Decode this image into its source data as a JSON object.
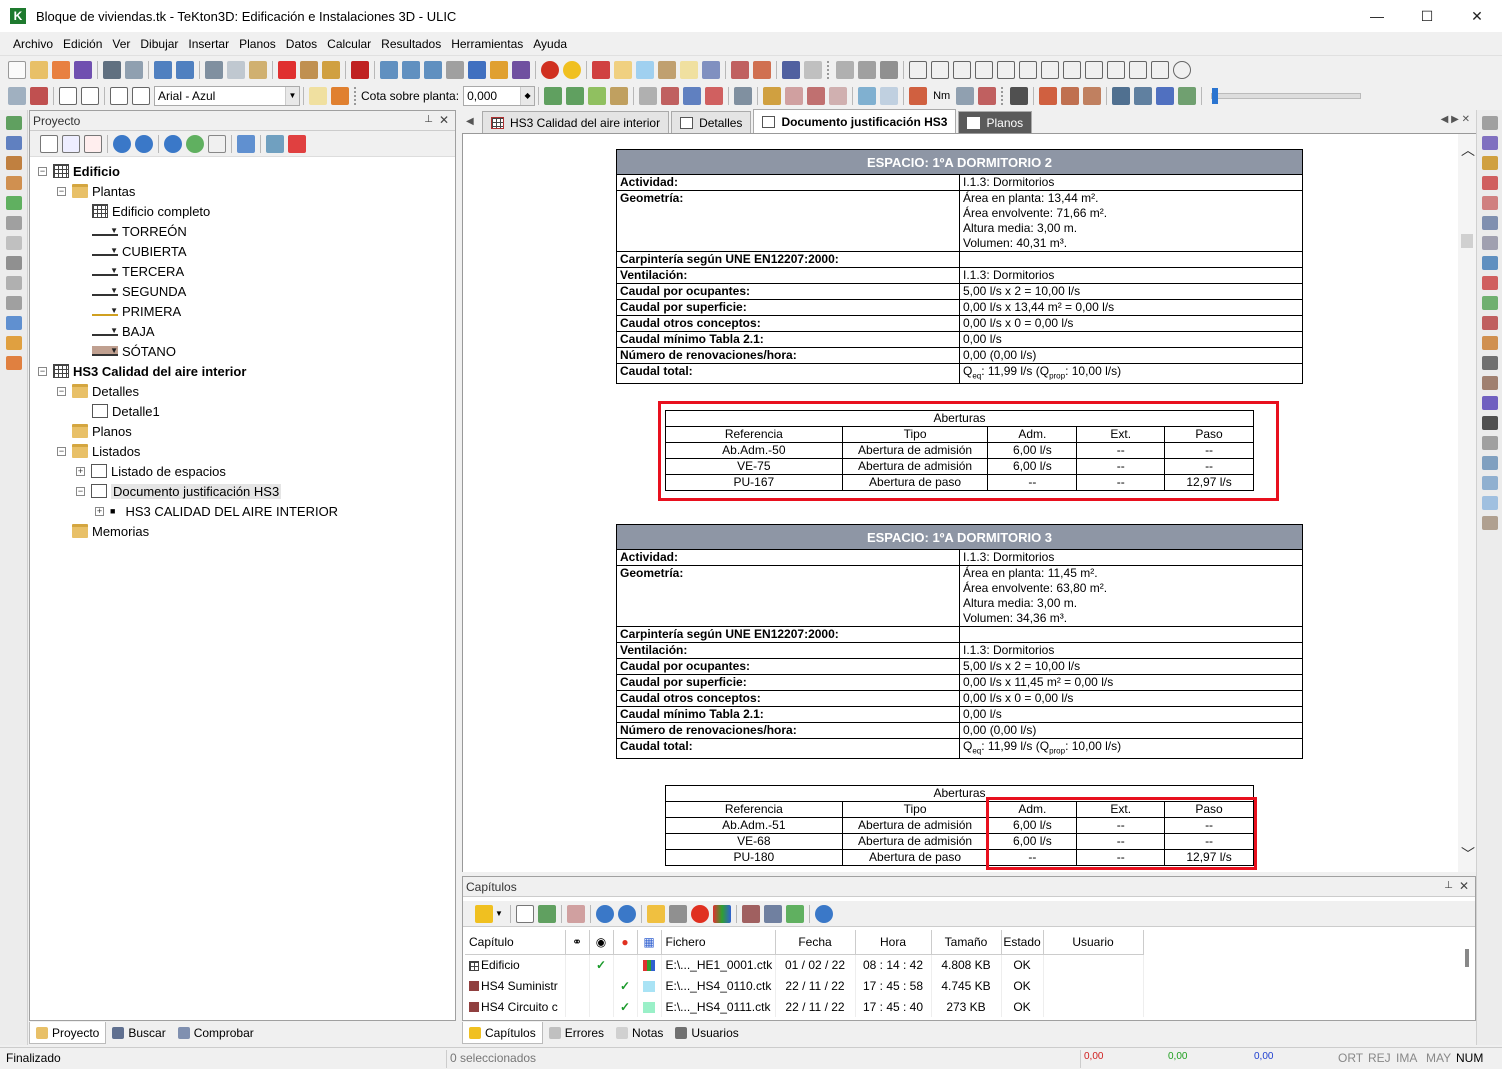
{
  "window": {
    "title": "Bloque de viviendas.tk - TeKton3D: Edificación e Instalaciones 3D - ULIC",
    "app_icon": "K",
    "minimize": "—",
    "maximize": "☐",
    "close": "✕"
  },
  "menu": [
    "Archivo",
    "Edición",
    "Ver",
    "Dibujar",
    "Insertar",
    "Planos",
    "Datos",
    "Calcular",
    "Resultados",
    "Herramientas",
    "Ayuda"
  ],
  "toolbar": {
    "font_combo": "Arial - Azul",
    "elevation_label": "Cota sobre planta:",
    "elevation_value": "0,000",
    "units": "Nm"
  },
  "project_panel": {
    "title": "Proyecto",
    "tree": {
      "edificio": "Edificio",
      "plantas": "Plantas",
      "edificio_completo": "Edificio completo",
      "levels": [
        "TORREÓN",
        "CUBIERTA",
        "TERCERA",
        "SEGUNDA",
        "PRIMERA",
        "BAJA",
        "SÓTANO"
      ],
      "hs3": "HS3 Calidad del aire interior",
      "detalles": "Detalles",
      "detalle1": "Detalle1",
      "planos": "Planos",
      "listados": "Listados",
      "listado_espacios": "Listado de espacios",
      "documento": "Documento justificación HS3",
      "hs3_upper": "HS3 CALIDAD DEL AIRE INTERIOR",
      "memorias": "Memorias"
    },
    "tabs": [
      "Proyecto",
      "Buscar",
      "Comprobar"
    ]
  },
  "doc_tabs": [
    "HS3 Calidad del aire interior",
    "Detalles",
    "Documento justificación HS3",
    "Planos"
  ],
  "document": {
    "spaces": [
      {
        "title": "ESPACIO: 1ºA DORMITORIO 2",
        "actividad_label": "Actividad:",
        "actividad": "I.1.3: Dormitorios",
        "geometria_label": "Geometría:",
        "area_planta": "Área en planta: 13,44 m².",
        "area_envolvente": "Área envolvente: 71,66 m².",
        "altura": "Altura media: 3,00 m.",
        "volumen": "Volumen: 40,31 m³.",
        "carpinteria_label": "Carpintería según UNE EN12207:2000:",
        "carpinteria": "",
        "ventilacion_label": "Ventilación:",
        "ventilacion": "I.1.3: Dormitorios",
        "ocupantes_label": "Caudal por ocupantes:",
        "ocupantes": "5,00 l/s x 2 = 10,00 l/s",
        "superficie_label": "Caudal por superficie:",
        "superficie": "0,00 l/s x 13,44 m² = 0,00 l/s",
        "otros_label": "Caudal otros conceptos:",
        "otros": "0,00 l/s x 0 = 0,00 l/s",
        "minimo_label": "Caudal mínimo Tabla 2.1:",
        "minimo": "0,00 l/s",
        "renov_label": "Número de renovaciones/hora:",
        "renov": "0,00 (0,00 l/s)",
        "total_label": "Caudal total:",
        "total_q": "Q",
        "total_eq": "eq",
        "total_mid": ": 11,99 l/s (Q",
        "total_prop": "prop",
        "total_end": ": 10,00 l/s)",
        "aberturas": {
          "title": "Aberturas",
          "headers": [
            "Referencia",
            "Tipo",
            "Adm.",
            "Ext.",
            "Paso"
          ],
          "rows": [
            [
              "Ab.Adm.-50",
              "Abertura de admisión",
              "6,00 l/s",
              "--",
              "--"
            ],
            [
              "VE-75",
              "Abertura de admisión",
              "6,00 l/s",
              "--",
              "--"
            ],
            [
              "PU-167",
              "Abertura de paso",
              "--",
              "--",
              "12,97 l/s"
            ]
          ]
        }
      },
      {
        "title": "ESPACIO: 1ºA DORMITORIO 3",
        "actividad_label": "Actividad:",
        "actividad": "I.1.3: Dormitorios",
        "geometria_label": "Geometría:",
        "area_planta": "Área en planta: 11,45 m².",
        "area_envolvente": "Área envolvente: 63,80 m².",
        "altura": "Altura media: 3,00 m.",
        "volumen": "Volumen: 34,36 m³.",
        "carpinteria_label": "Carpintería según UNE EN12207:2000:",
        "carpinteria": "",
        "ventilacion_label": "Ventilación:",
        "ventilacion": "I.1.3: Dormitorios",
        "ocupantes_label": "Caudal por ocupantes:",
        "ocupantes": "5,00 l/s x 2 = 10,00 l/s",
        "superficie_label": "Caudal por superficie:",
        "superficie": "0,00 l/s x 11,45 m² = 0,00 l/s",
        "otros_label": "Caudal otros conceptos:",
        "otros": "0,00 l/s x 0 = 0,00 l/s",
        "minimo_label": "Caudal mínimo Tabla 2.1:",
        "minimo": "0,00 l/s",
        "renov_label": "Número de renovaciones/hora:",
        "renov": "0,00 (0,00 l/s)",
        "total_label": "Caudal total:",
        "total_q": "Q",
        "total_eq": "eq",
        "total_mid": ": 11,99 l/s (Q",
        "total_prop": "prop",
        "total_end": ": 10,00 l/s)",
        "aberturas": {
          "title": "Aberturas",
          "headers": [
            "Referencia",
            "Tipo",
            "Adm.",
            "Ext.",
            "Paso"
          ],
          "rows": [
            [
              "Ab.Adm.-51",
              "Abertura de admisión",
              "6,00 l/s",
              "--",
              "--"
            ],
            [
              "VE-68",
              "Abertura de admisión",
              "6,00 l/s",
              "--",
              "--"
            ],
            [
              "PU-180",
              "Abertura de paso",
              "--",
              "--",
              "12,97 l/s"
            ]
          ]
        }
      }
    ]
  },
  "capitulos": {
    "title": "Capítulos",
    "headers": [
      "Capítulo",
      "Fichero",
      "Fecha",
      "Hora",
      "Tamaño",
      "Estado",
      "Usuario"
    ],
    "rows": [
      {
        "capitulo": "Edificio",
        "fichero": "E:\\..._HE1_0001.ctk",
        "fecha": "01 / 02 / 22",
        "hora": "08 : 14 : 42",
        "tamano": "4.808 KB",
        "estado": "OK",
        "usuario": "",
        "color": "multi"
      },
      {
        "capitulo": "HS4 Suministr",
        "fichero": "E:\\..._HS4_0110.ctk",
        "fecha": "22 / 11 / 22",
        "hora": "17 : 45 : 58",
        "tamano": "4.745 KB",
        "estado": "OK",
        "usuario": "",
        "color": "#a9e3f5"
      },
      {
        "capitulo": "HS4 Circuito c",
        "fichero": "E:\\..._HS4_0111.ctk",
        "fecha": "22 / 11 / 22",
        "hora": "17 : 45 : 40",
        "tamano": "273 KB",
        "estado": "OK",
        "usuario": "",
        "color": "#9af0c8"
      }
    ],
    "tabs": [
      "Capítulos",
      "Errores",
      "Notas",
      "Usuarios"
    ]
  },
  "status": {
    "left": "Finalizado",
    "selected": "0 seleccionados",
    "r": "0,00",
    "g": "0,00",
    "b": "0,00",
    "indicators": [
      "ORT",
      "REJ",
      "IMA",
      "MAY",
      "NUM"
    ]
  },
  "colors": {
    "table_header": "#8e96a5",
    "highlight_box": "#e8101e",
    "app_green": "#1e7a2e"
  }
}
